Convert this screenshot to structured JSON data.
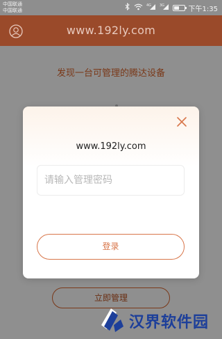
{
  "status_bar": {
    "carrier1": "中国联通",
    "carrier2": "中国联通",
    "time": "下午1:35",
    "signal_label1": "4G",
    "signal_label2": "3G",
    "battery_level": 0.5
  },
  "header": {
    "title": "www.192ly.com",
    "user_icon": "user-circle-icon"
  },
  "main": {
    "found_text": "发现一台可管理的腾达设备",
    "manage_button": "立即管理"
  },
  "modal": {
    "url": "www.192ly.com",
    "password_placeholder": "请输入管理密码",
    "password_value": "",
    "login_button": "登录",
    "close_icon": "close-icon"
  },
  "watermark": {
    "text": "汉界软件园"
  },
  "colors": {
    "overlay": "#8f8f8f",
    "header": "#9a4a2a",
    "accent": "#d8764a",
    "watermark": "#1d3f9a"
  }
}
